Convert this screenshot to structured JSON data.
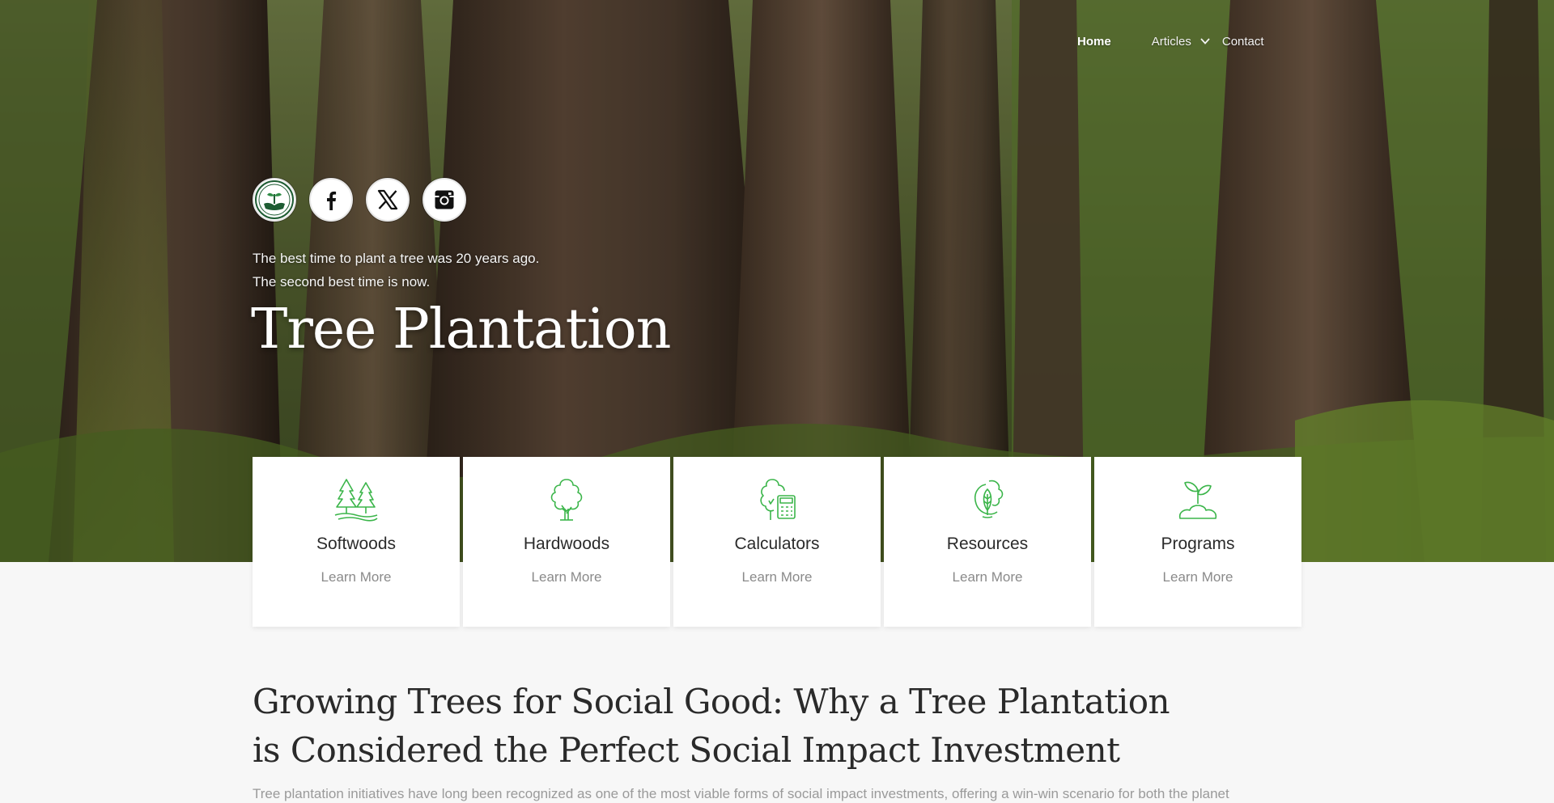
{
  "nav": {
    "items": [
      "Home",
      "Articles",
      "Contact"
    ],
    "active": "Home"
  },
  "social": {
    "icons": [
      "seedling-hands-logo-icon",
      "facebook-icon",
      "x-twitter-icon",
      "instagram-icon"
    ]
  },
  "hero": {
    "tagline_line1": "The best time to plant a tree was 20 years ago.",
    "tagline_line2": "The second best time is now.",
    "title": "Tree Plantation"
  },
  "cards": [
    {
      "title": "Softwoods",
      "link": "Learn More",
      "icon": "pine-trees-icon"
    },
    {
      "title": "Hardwoods",
      "link": "Learn More",
      "icon": "deciduous-tree-icon"
    },
    {
      "title": "Calculators",
      "link": "Learn More",
      "icon": "tree-calculator-icon"
    },
    {
      "title": "Resources",
      "link": "Learn More",
      "icon": "leaf-resource-icon"
    },
    {
      "title": "Programs",
      "link": "Learn More",
      "icon": "sprout-icon"
    }
  ],
  "article": {
    "title": "Growing Trees for Social Good: Why a Tree Plantation is Considered the Perfect Social Impact Investment",
    "excerpt": "Tree plantation initiatives have long been recognized as one of the most viable forms of social impact investments, offering a win-win scenario for both the planet"
  },
  "colors": {
    "accent_green": "#3bb54a",
    "hero_text": "#ffffff",
    "body_bg": "#f7f7f7",
    "heading": "#2a2a2a",
    "muted": "#8a8a8a"
  }
}
